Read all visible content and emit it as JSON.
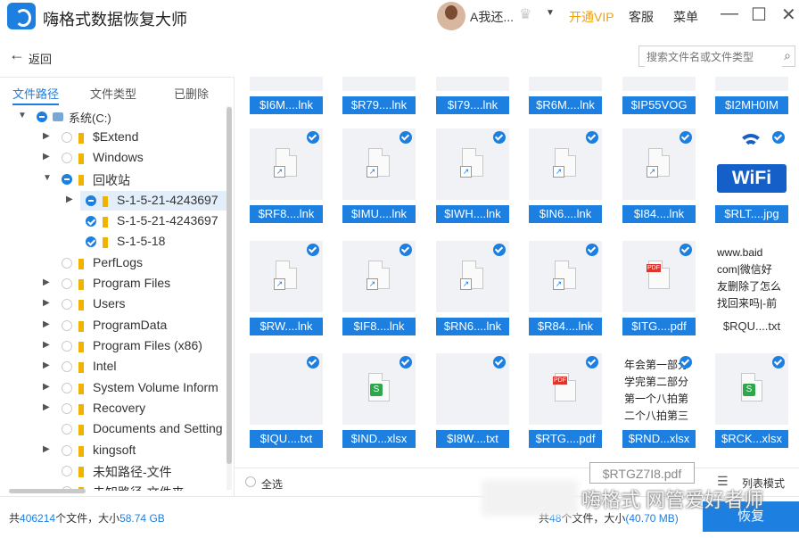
{
  "titlebar": {
    "app_title": "嗨格式数据恢复大师",
    "username": "A我还...",
    "vip": "开通VIP",
    "service": "客服",
    "menu": "菜单",
    "minimize": "—",
    "maximize": "☐",
    "close": "✕"
  },
  "nav": {
    "back": "返回"
  },
  "search": {
    "placeholder": "搜索文件名或文件类型"
  },
  "tabs": [
    "文件路径",
    "文件类型",
    "已删除"
  ],
  "tree": [
    {
      "label": "系统(C:)"
    },
    {
      "label": "$Extend"
    },
    {
      "label": "Windows"
    },
    {
      "label": "回收站"
    },
    {
      "label": "S-1-5-21-4243697"
    },
    {
      "label": "S-1-5-21-4243697"
    },
    {
      "label": "S-1-5-18"
    },
    {
      "label": "PerfLogs"
    },
    {
      "label": "Program Files"
    },
    {
      "label": "Users"
    },
    {
      "label": "ProgramData"
    },
    {
      "label": "Program Files (x86)"
    },
    {
      "label": "Intel"
    },
    {
      "label": "System Volume Inform"
    },
    {
      "label": "Recovery"
    },
    {
      "label": "Documents and Setting"
    },
    {
      "label": "kingsoft"
    },
    {
      "label": "未知路径-文件"
    },
    {
      "label": "未知路径-文件夹"
    }
  ],
  "files_row0": [
    "$I6M....lnk",
    "$R79....lnk",
    "$I79....lnk",
    "$R6M....lnk",
    "$IP55VOG",
    "$I2MH0IM"
  ],
  "files": [
    {
      "name": "$RF8....lnk",
      "type": "lnk"
    },
    {
      "name": "$IMU....lnk",
      "type": "lnk"
    },
    {
      "name": "$IWH....lnk",
      "type": "lnk"
    },
    {
      "name": "$IN6....lnk",
      "type": "lnk"
    },
    {
      "name": "$I84....lnk",
      "type": "lnk"
    },
    {
      "name": "$RLT....jpg",
      "type": "wifi"
    },
    {
      "name": "$RW....lnk",
      "type": "lnk"
    },
    {
      "name": "$IF8....lnk",
      "type": "lnk"
    },
    {
      "name": "$RN6....lnk",
      "type": "lnk"
    },
    {
      "name": "$R84....lnk",
      "type": "lnk"
    },
    {
      "name": "$ITG....pdf",
      "type": "pdf"
    },
    {
      "name": "$RQU....txt",
      "type": "txt1"
    },
    {
      "name": "$IQU....txt",
      "type": "blank"
    },
    {
      "name": "$IND...xlsx",
      "type": "xlsx"
    },
    {
      "name": "$I8W....txt",
      "type": "blank"
    },
    {
      "name": "$RTG....pdf",
      "type": "pdf"
    },
    {
      "name": "$RND...xlsx",
      "type": "txt2"
    },
    {
      "name": "$RCK...xlsx",
      "type": "xlsx"
    }
  ],
  "previews": {
    "wifi_text": "WiFi",
    "txt1": "www.baid\ncom|微信好\n友删除了怎么\n找回来吗|-前",
    "txt2": "年会第一部分\n学完第二部分\n第一个八拍第\n二个八拍第三"
  },
  "bottom": {
    "select_all": "全选",
    "tooltip": "$RTGZ7I8.pdf",
    "list_mode": "列表模式"
  },
  "status": {
    "prefix": "共",
    "total_files": "406214",
    "mid": "个文件，大小",
    "total_size": "58.74 GB",
    "sel_prefix": "共",
    "sel_files": "48",
    "sel_mid": "个文件，大小",
    "sel_size": "(40.70 MB)"
  },
  "recover_button": "恢复",
  "watermark": "嗨格式 网管爱好者师",
  "colors": {
    "accent": "#1d7fe0",
    "vip": "#f2a100"
  }
}
